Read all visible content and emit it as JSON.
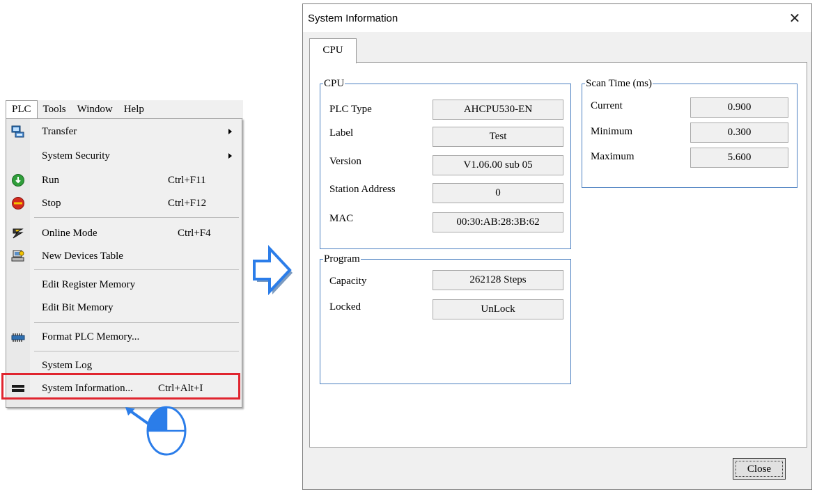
{
  "menubar": {
    "items": [
      {
        "label": "PLC"
      },
      {
        "label": "Tools"
      },
      {
        "label": "Window"
      },
      {
        "label": "Help"
      }
    ]
  },
  "menu": {
    "items": [
      {
        "label": "Transfer",
        "shortcut": "",
        "submenu": true,
        "icon": "transfer-icon"
      },
      {
        "label": "System Security",
        "shortcut": "",
        "submenu": true,
        "icon": ""
      },
      {
        "label": "Run",
        "shortcut": "Ctrl+F11",
        "icon": "run-icon"
      },
      {
        "label": "Stop",
        "shortcut": "Ctrl+F12",
        "icon": "stop-icon"
      },
      {
        "label": "Online Mode",
        "shortcut": "Ctrl+F4",
        "icon": "online-mode-icon"
      },
      {
        "label": "New Devices Table",
        "shortcut": "",
        "icon": "devices-table-icon"
      },
      {
        "label": "Edit Register Memory",
        "shortcut": "",
        "icon": ""
      },
      {
        "label": "Edit Bit Memory",
        "shortcut": "",
        "icon": ""
      },
      {
        "label": "Format PLC Memory...",
        "shortcut": "",
        "icon": "memory-chip-icon"
      },
      {
        "label": "System Log",
        "shortcut": "",
        "icon": ""
      },
      {
        "label": "System Information...",
        "shortcut": "Ctrl+Alt+I",
        "icon": "system-info-icon"
      }
    ]
  },
  "dialog": {
    "title": "System Information",
    "close_glyph": "✕",
    "tab": "CPU",
    "cpu_group": {
      "title": "CPU",
      "rows": [
        {
          "label": "PLC Type",
          "value": "AHCPU530-EN"
        },
        {
          "label": "Label",
          "value": "Test"
        },
        {
          "label": "Version",
          "value": "V1.06.00 sub 05"
        },
        {
          "label": "Station Address",
          "value": "0"
        },
        {
          "label": "MAC",
          "value": "00:30:AB:28:3B:62"
        }
      ]
    },
    "scan_group": {
      "title": "Scan Time (ms)",
      "rows": [
        {
          "label": "Current",
          "value": "0.900"
        },
        {
          "label": "Minimum",
          "value": "0.300"
        },
        {
          "label": "Maximum",
          "value": "5.600"
        }
      ]
    },
    "program_group": {
      "title": "Program",
      "rows": [
        {
          "label": "Capacity",
          "value": "262128 Steps"
        },
        {
          "label": "Locked",
          "value": "UnLock"
        }
      ]
    },
    "close_label": "Close"
  },
  "colors": {
    "highlight": "#e0252f",
    "group_border": "#4a7fc0",
    "arrow_blue": "#2b7de9"
  }
}
